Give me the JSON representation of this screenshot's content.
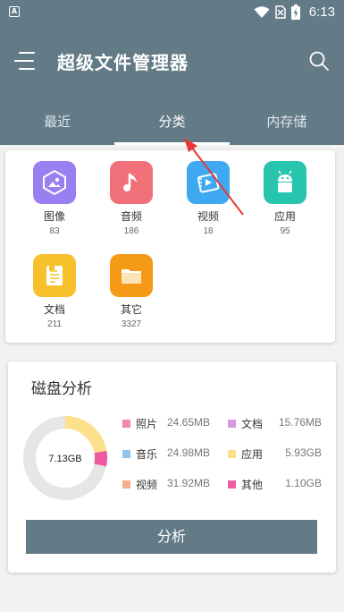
{
  "status_bar": {
    "time": "6:13",
    "app_badge": "A"
  },
  "header": {
    "title": "超级文件管理器"
  },
  "tabs": [
    {
      "label": "最近",
      "active": false
    },
    {
      "label": "分类",
      "active": true
    },
    {
      "label": "内存储",
      "active": false
    }
  ],
  "categories": [
    {
      "label": "图像",
      "count": "83",
      "icon": "image-icon",
      "color": "#9a7ff2"
    },
    {
      "label": "音频",
      "count": "186",
      "icon": "music-icon",
      "color": "#f2707a"
    },
    {
      "label": "视频",
      "count": "18",
      "icon": "video-icon",
      "color": "#3ea8f0"
    },
    {
      "label": "应用",
      "count": "95",
      "icon": "android-icon",
      "color": "#27c4ae"
    },
    {
      "label": "文档",
      "count": "211",
      "icon": "document-icon",
      "color": "#f7c02c"
    },
    {
      "label": "其它",
      "count": "3327",
      "icon": "folder-icon",
      "color": "#f49a16"
    }
  ],
  "disk": {
    "title": "磁盘分析",
    "total": "7.13GB",
    "items": [
      {
        "label": "照片",
        "value": "24.65MB",
        "color": "#ef8aa8"
      },
      {
        "label": "音乐",
        "value": "24.98MB",
        "color": "#8fc3ee"
      },
      {
        "label": "视频",
        "value": "31.92MB",
        "color": "#f6b08e"
      },
      {
        "label": "文档",
        "value": "15.76MB",
        "color": "#d59ae0"
      },
      {
        "label": "应用",
        "value": "5.93GB",
        "color": "#fde08c"
      },
      {
        "label": "其他",
        "value": "1.10GB",
        "color": "#ef5aa1"
      }
    ],
    "button_label": "分析"
  }
}
